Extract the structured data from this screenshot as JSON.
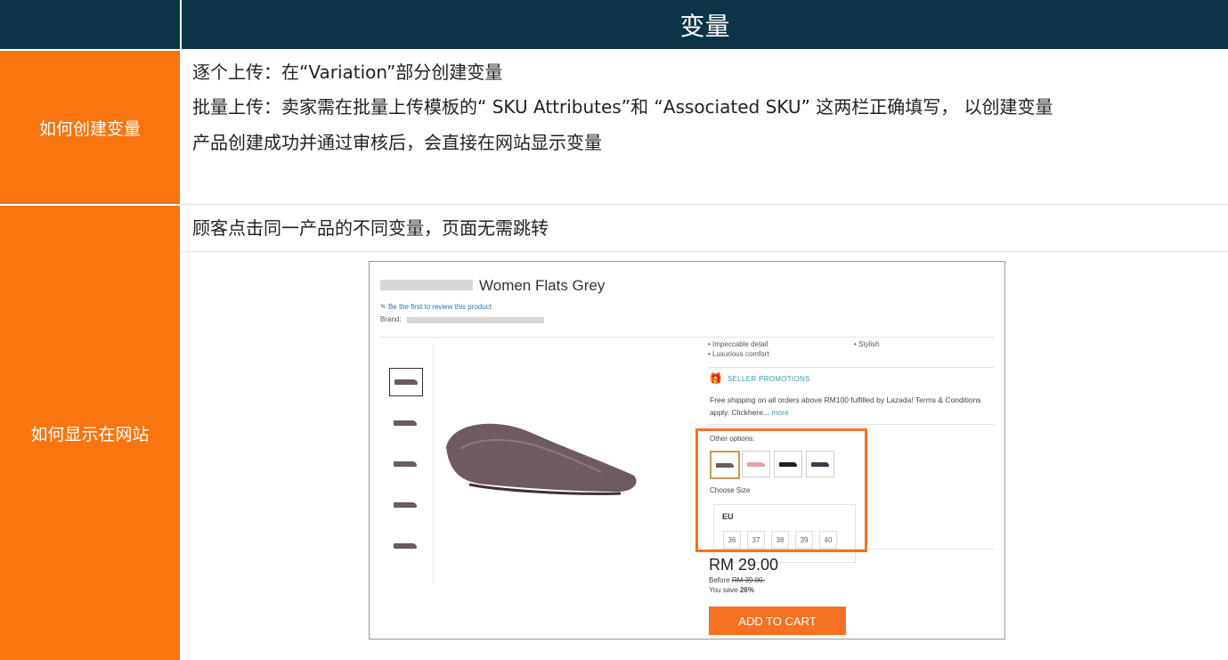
{
  "header": {
    "title": "变量"
  },
  "rows": [
    {
      "label": "如何创建变量",
      "lines": [
        "逐个上传：在“Variation”部分创建变量",
        "批量上传：卖家需在批量上传模板的“ SKU Attributes”和 “Associated SKU” 这两栏正确填写， 以创建变量",
        "产品创建成功并通过审核后，会直接在网站显示变量"
      ]
    },
    {
      "label": "如何显示在网站",
      "lines": [
        "顾客点击同一产品的不同变量，页面无需跳转"
      ]
    }
  ],
  "product": {
    "title": "Women Flats Grey",
    "review_link": "Be the first to review this product",
    "brand_label": "Brand:",
    "features": [
      "Impeccable detail",
      "Luxurious comfort",
      "Stylish"
    ],
    "promo_title": "SELLER PROMOTIONS",
    "promo_text": "Free shipping on all orders above RM100 fulfilled by Lazada! Terms & Conditions apply. Clickhere...",
    "promo_more": "more",
    "other_options_label": "Other options:",
    "option_colors": [
      "#6b5a5e",
      "#e8a1ab",
      "#1e1e24",
      "#3c3b48"
    ],
    "choose_size_label": "Choose Size",
    "size_system": "EU",
    "sizes": [
      "36",
      "37",
      "38",
      "39",
      "40"
    ],
    "price": "RM 29.00",
    "before_label": "Before",
    "before_price": "RM 39.00.",
    "save_label": "You save",
    "save_percent": "26%",
    "cart_label": "ADD TO CART",
    "accent": "#f57224"
  }
}
